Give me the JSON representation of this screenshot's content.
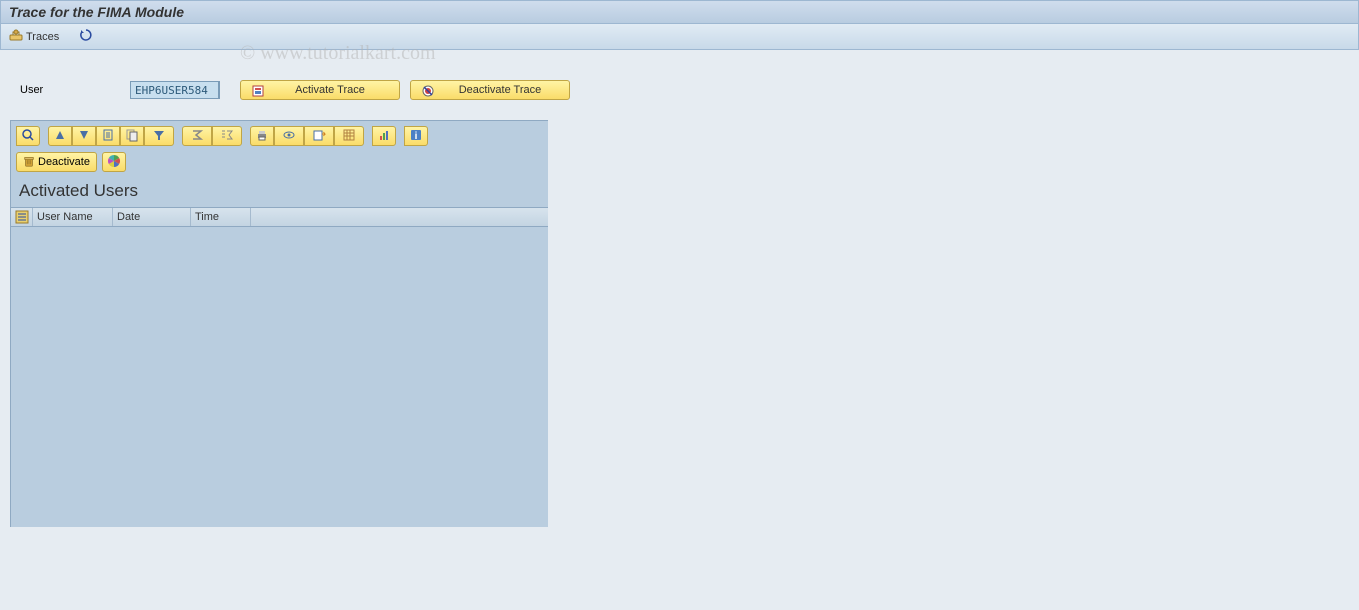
{
  "header": {
    "title": "Trace for the FIMA Module"
  },
  "toolbar": {
    "traces_label": "Traces"
  },
  "watermark": "© www.tutorialkart.com",
  "user_section": {
    "label": "User",
    "value": "EHP6USER584",
    "activate_label": "Activate Trace",
    "deactivate_label": "Deactivate Trace"
  },
  "grid": {
    "deactivate_label": "Deactivate",
    "section_title": "Activated Users",
    "columns": {
      "user_name": "User Name",
      "date": "Date",
      "time": "Time"
    },
    "rows": []
  }
}
